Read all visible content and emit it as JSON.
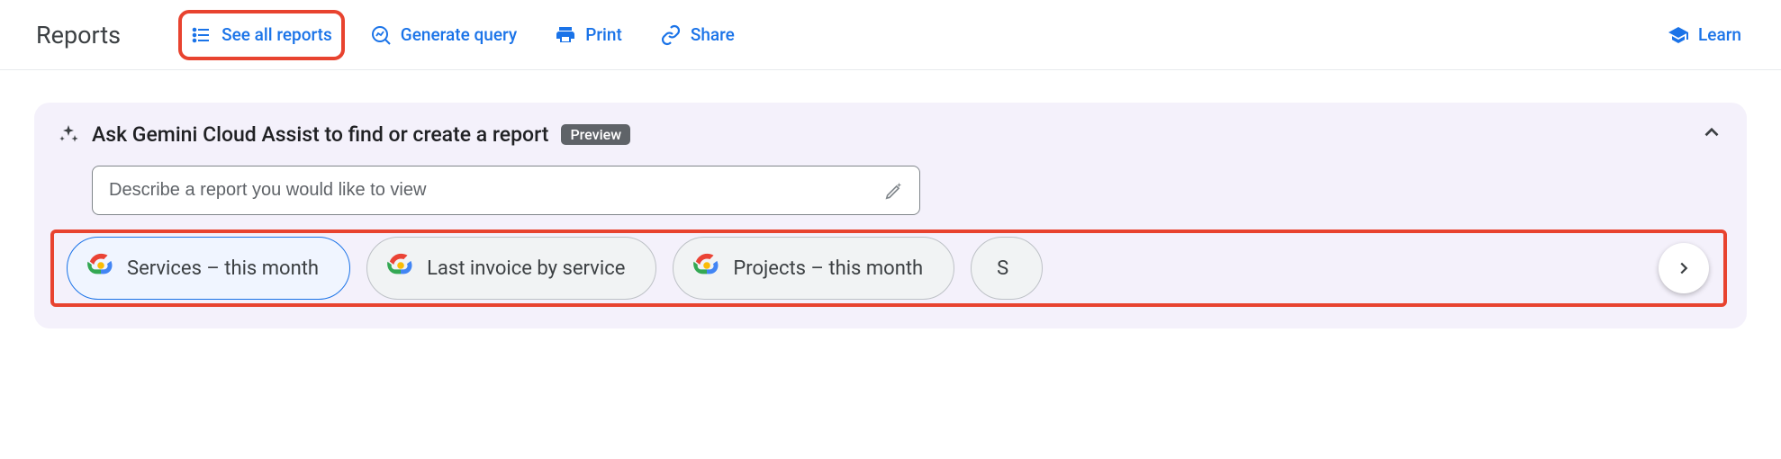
{
  "page": {
    "title": "Reports"
  },
  "header": {
    "see_all": "See all reports",
    "generate": "Generate query",
    "print": "Print",
    "share": "Share",
    "learn": "Learn"
  },
  "assist": {
    "sparkle": "✦",
    "title": "Ask Gemini Cloud Assist to find or create a report",
    "badge": "Preview",
    "placeholder": "Describe a report you would like to view",
    "chips": [
      {
        "label": "Services – this month",
        "selected": true
      },
      {
        "label": "Last invoice by service",
        "selected": false
      },
      {
        "label": "Projects – this month",
        "selected": false
      }
    ],
    "overflow_initial": "S"
  }
}
